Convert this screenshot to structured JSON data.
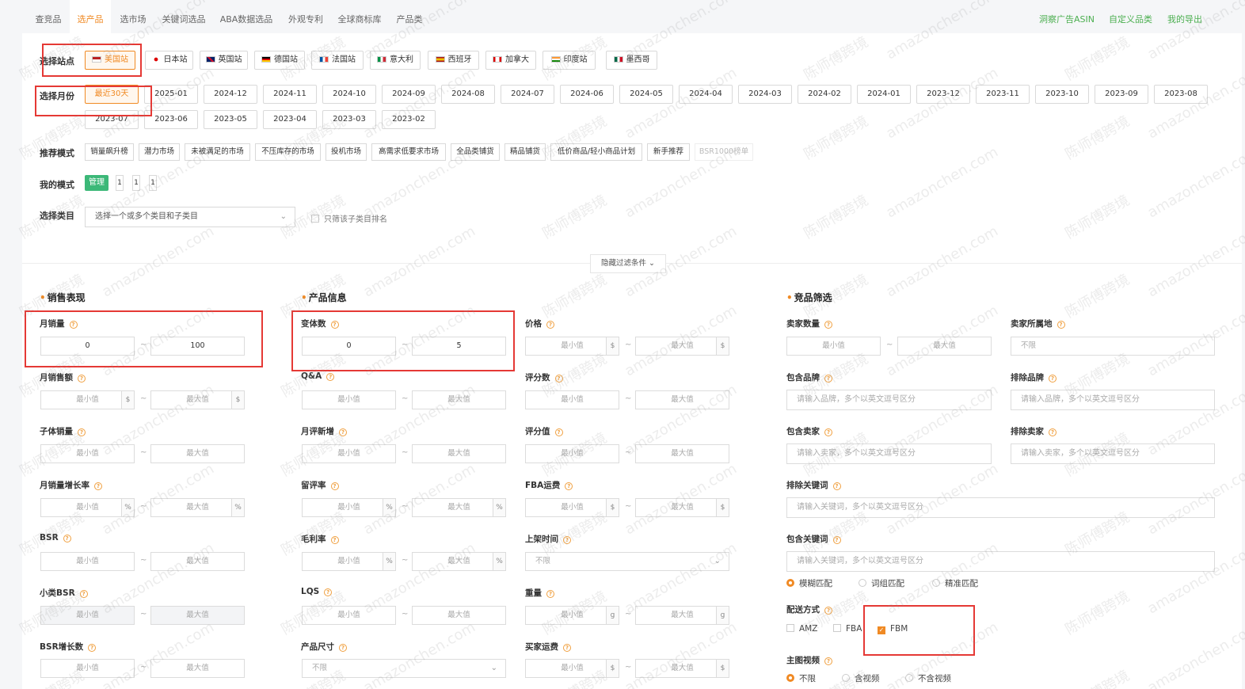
{
  "nav": {
    "tabs": [
      "查竞品",
      "选产品",
      "选市场",
      "关键词选品",
      "ABA数据选品",
      "外观专利",
      "全球商标库",
      "产品类"
    ],
    "right": [
      "洞察广告ASIN",
      "自定义品类",
      "我的导出"
    ]
  },
  "site": {
    "label": "选择站点",
    "items": [
      {
        "name": "美国站",
        "selected": true
      },
      {
        "name": "日本站"
      },
      {
        "name": "英国站"
      },
      {
        "name": "德国站"
      },
      {
        "name": "法国站"
      },
      {
        "name": "意大利"
      },
      {
        "name": "西班牙"
      },
      {
        "name": "加拿大"
      },
      {
        "name": "印度站"
      },
      {
        "name": "墨西哥"
      }
    ]
  },
  "month": {
    "label": "选择月份",
    "row1": [
      "最近30天",
      "2025-01",
      "2024-12",
      "2024-11",
      "2024-10",
      "2024-09",
      "2024-08",
      "2024-07",
      "2024-06",
      "2024-05",
      "2024-04",
      "2024-03",
      "2024-02",
      "2024-01",
      "2023-12",
      "2023-11",
      "2023-10",
      "2023-09",
      "2023-08"
    ],
    "row2": [
      "2023-07",
      "2023-06",
      "2023-05",
      "2023-04",
      "2023-03",
      "2023-02"
    ]
  },
  "mode": {
    "label": "推荐模式",
    "items": [
      "销量飙升榜",
      "潜力市场",
      "未被满足的市场",
      "不压库存的市场",
      "投机市场",
      "高需求低要求市场",
      "全品类铺货",
      "精品铺货",
      "低价商品/轻小商品计划",
      "新手推荐",
      "BSR1000榜单"
    ]
  },
  "mymode": {
    "label": "我的模式",
    "manage": "管理",
    "slots": [
      "1",
      "1",
      "1"
    ]
  },
  "category": {
    "label": "选择类目",
    "placeholder": "选择一个或多个类目和子类目",
    "only_sub": "只筛该子类目排名"
  },
  "toggle": "隐藏过滤条件",
  "sections": {
    "sales": "销售表现",
    "product": "产品信息",
    "competitor": "竞品筛选"
  },
  "placeholders": {
    "min": "最小值",
    "max": "最大值",
    "unlimited": "不限"
  },
  "sales_fields": {
    "monthly_sales": {
      "label": "月销量",
      "min": "0",
      "max": "100"
    },
    "monthly_revenue": "月销售额",
    "child_sales": "子体销量",
    "sales_growth": "月销量增长率",
    "bsr": "BSR",
    "sub_bsr": "小类BSR",
    "bsr_growth": "BSR增长数"
  },
  "product_fields": {
    "variants": {
      "label": "变体数",
      "min": "0",
      "max": "5"
    },
    "qa": "Q&A",
    "monthly_reviews": "月评新增",
    "review_rate": "留评率",
    "gross_margin": "毛利率",
    "lqs": "LQS",
    "size": "产品尺寸",
    "price": "价格",
    "rating_count": "评分数",
    "rating_value": "评分值",
    "fba_fee": "FBA运费",
    "launch": "上架时间",
    "weight": "重量",
    "buyer_ship": "买家运费"
  },
  "units": {
    "dollar": "$",
    "percent": "%",
    "gram": "g"
  },
  "competitor_fields": {
    "seller_count": "卖家数量",
    "seller_location": "卖家所属地",
    "include_brand": "包含品牌",
    "exclude_brand": "排除品牌",
    "brand_ph": "请输入品牌，多个以英文逗号区分",
    "include_seller": "包含卖家",
    "exclude_seller": "排除卖家",
    "seller_ph": "请输入卖家，多个以英文逗号区分",
    "exclude_kw": "排除关键词",
    "include_kw": "包含关键词",
    "kw_ph": "请输入关键词，多个以英文逗号区分",
    "match": [
      "模糊匹配",
      "词组匹配",
      "精准匹配"
    ],
    "delivery": {
      "label": "配送方式",
      "options": [
        "AMZ",
        "FBA",
        "FBM"
      ]
    },
    "video": {
      "label": "主图视频",
      "options": [
        "不限",
        "含视频",
        "不含视频"
      ]
    }
  },
  "watermark": [
    "陈师傅跨境",
    "amazonchen.com"
  ],
  "colors": {
    "accent": "#f08a24",
    "green": "#3cb878",
    "highlight": "#e53935"
  }
}
